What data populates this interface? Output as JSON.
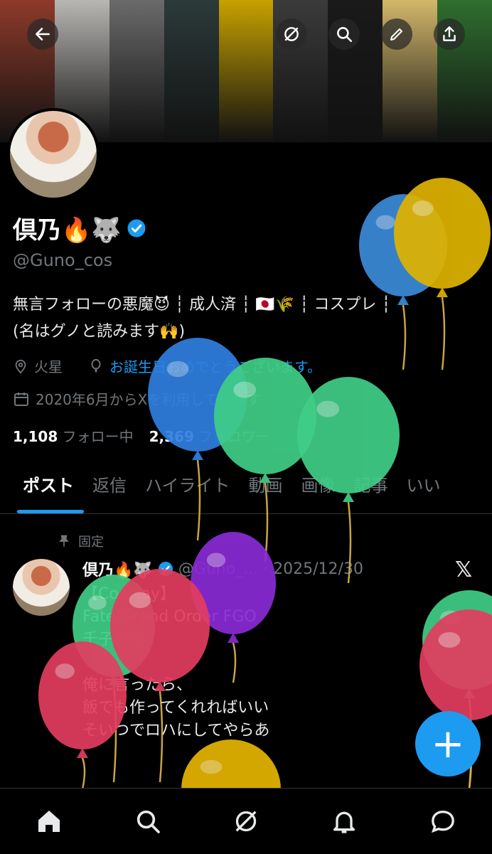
{
  "banner": {
    "colors": [
      "#8e3a2a",
      "#b9b7b4",
      "#6a6a6a",
      "#2c3a3a",
      "#c7a100",
      "#3b3b3b",
      "#1a1a1a",
      "#d3b76a",
      "#2f6f2f"
    ]
  },
  "top_actions": [
    "back-icon",
    "grok-icon",
    "search-icon",
    "edit-icon",
    "share-icon"
  ],
  "profile": {
    "name": "倶乃🔥🐺",
    "handle": "@Guno_cos",
    "bio_line1": "無言フォローの悪魔😈 ┆ 成人済 ┆ 🇯🇵🌾 ┆ コスプレ ┆",
    "bio_line2": "(名はグノと読みます🙌)",
    "location": "火星",
    "birthday_text": "お誕生日おめでとうございます。",
    "joined": "2020年6月からXを利用しています",
    "following_count": "1,108",
    "following_label": "フォロー中",
    "followers_count": "2,369",
    "followers_label": "フォロワー"
  },
  "tabs": [
    "ポスト",
    "返信",
    "ハイライト",
    "動画",
    "画像",
    "記事",
    "いい"
  ],
  "post": {
    "pinned_label": "固定",
    "name": "倶乃🔥🐺",
    "handle_date": "@Guno_... · 2025/12/30",
    "text": "【Cosplay】\nFate/Grand Order  FGO\n千子村正\n\n俺に言ったら、\n飯でも作ってくれればいい\nそいつでロハにしてやらあ"
  },
  "fab_label": "+",
  "accent_color": "#1d9bf0",
  "verified_color": "#1d9bf0"
}
